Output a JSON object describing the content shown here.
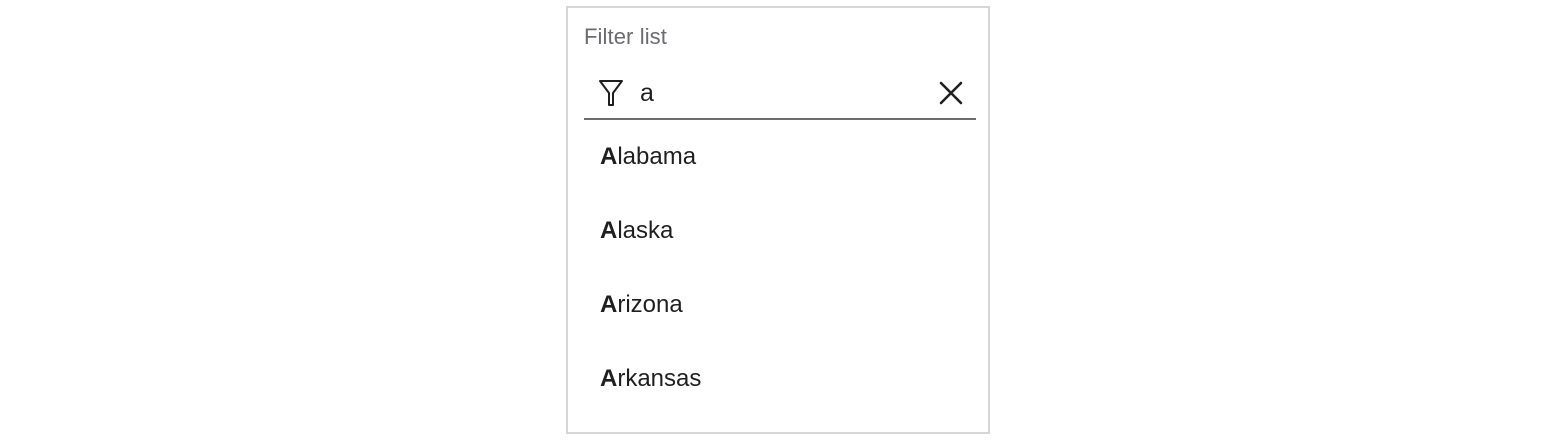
{
  "filter": {
    "label": "Filter list",
    "query": "a",
    "filter_icon": "filter-icon",
    "clear_icon": "close-icon"
  },
  "results": [
    {
      "match": "A",
      "rest": "labama"
    },
    {
      "match": "A",
      "rest": "laska"
    },
    {
      "match": "A",
      "rest": "rizona"
    },
    {
      "match": "A",
      "rest": "rkansas"
    }
  ],
  "colors": {
    "border": "#d6d6d9",
    "label": "#6b6b70",
    "text": "#1f1f22",
    "underline": "#6b6b70"
  }
}
